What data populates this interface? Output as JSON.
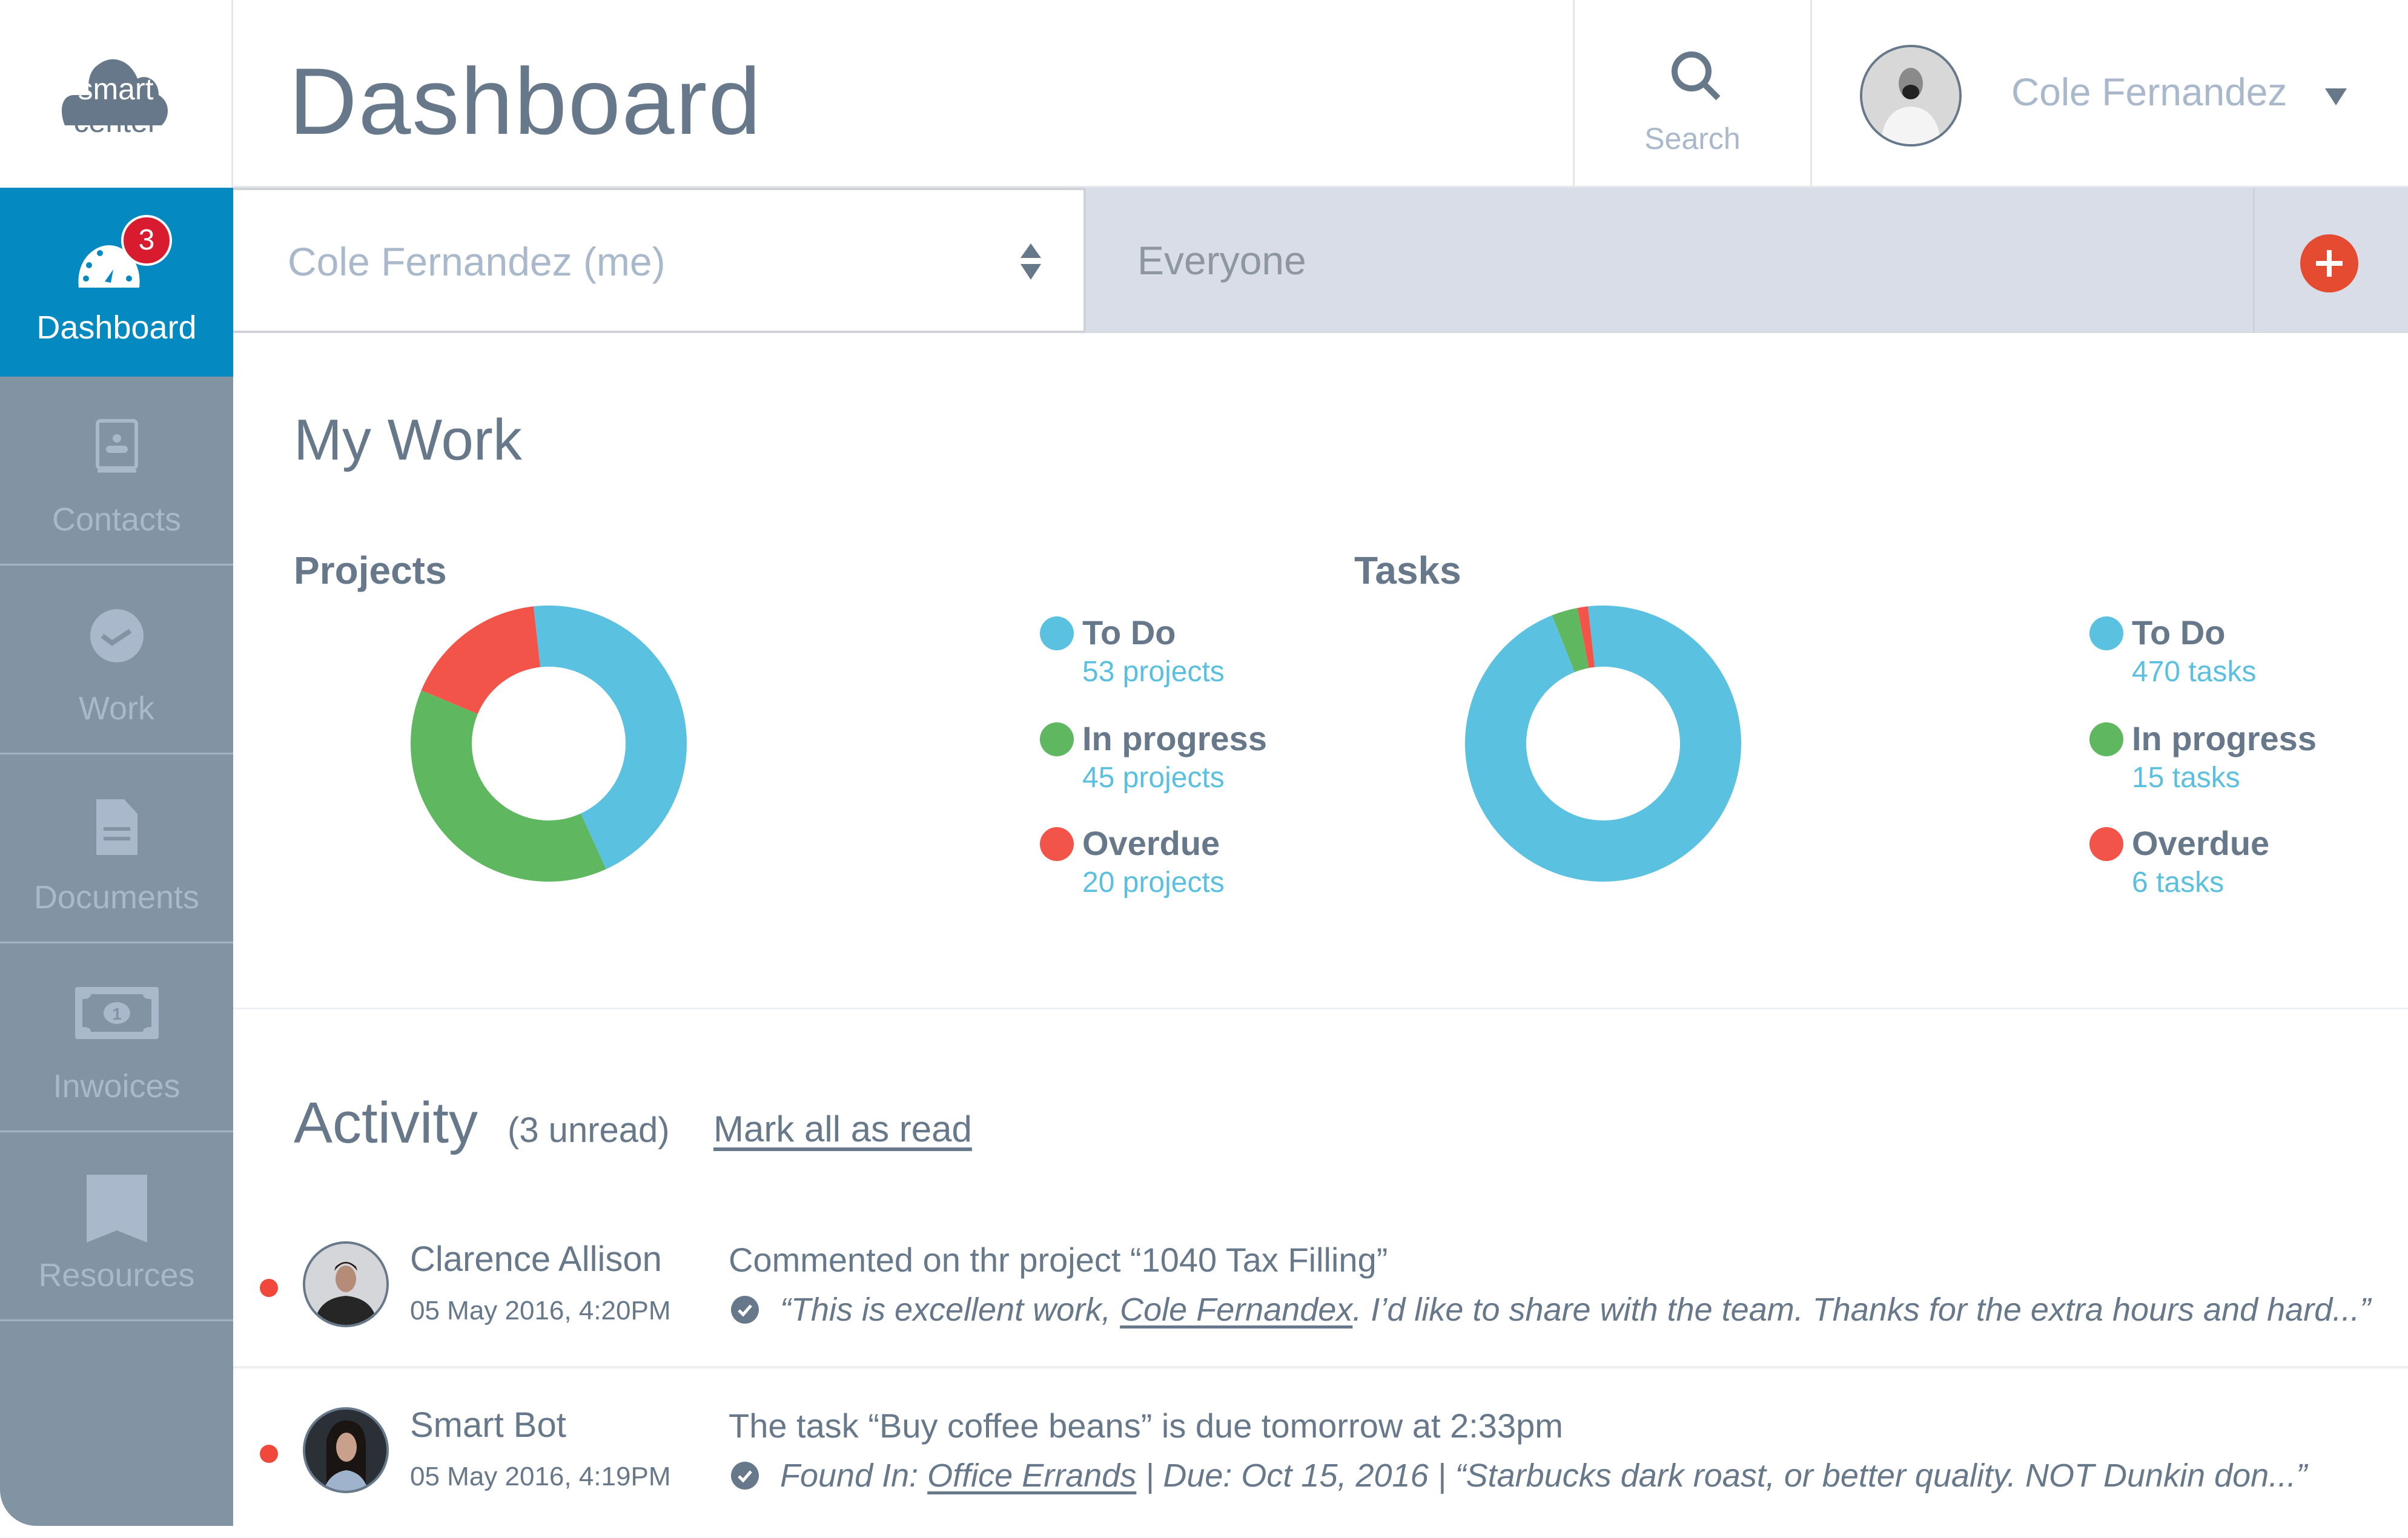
{
  "app": {
    "logo_line1": "smart",
    "logo_line2": "center"
  },
  "header": {
    "title": "Dashboard",
    "search_label": "Search",
    "user_name": "Cole Fernandez"
  },
  "sidebar": {
    "items": [
      {
        "label": "Dashboard",
        "icon": "dashboard-gauge-icon",
        "active": true,
        "badge": "3"
      },
      {
        "label": "Contacts",
        "icon": "contact-card-icon"
      },
      {
        "label": "Work",
        "icon": "check-circle-icon"
      },
      {
        "label": "Documents",
        "icon": "document-icon"
      },
      {
        "label": "Inwoices",
        "icon": "banknote-icon"
      },
      {
        "label": "Resources",
        "icon": "bookmark-icon"
      }
    ]
  },
  "filter": {
    "person_selected": "Cole Fernandez (me)",
    "scope": "Everyone"
  },
  "my_work": {
    "title": "My Work"
  },
  "colors": {
    "todo": "#5bc1e0",
    "in_progress": "#5fb760",
    "overdue": "#f35449",
    "accent": "#0589c1",
    "add": "#e54b30"
  },
  "chart_data": [
    {
      "type": "pie",
      "title": "Projects",
      "categories": [
        "To Do",
        "In progress",
        "Overdue"
      ],
      "values": [
        53,
        45,
        20
      ],
      "value_labels": [
        "53 projects",
        "45 projects",
        "20 projects"
      ],
      "donut": true,
      "legend": "right"
    },
    {
      "type": "pie",
      "title": "Tasks",
      "categories": [
        "To Do",
        "In progress",
        "Overdue"
      ],
      "values": [
        470,
        15,
        6
      ],
      "value_labels": [
        "470 tasks",
        "15 tasks",
        "6 tasks"
      ],
      "donut": true,
      "legend": "right"
    }
  ],
  "activity": {
    "title": "Activity",
    "unread": "(3 unread)",
    "mark_all_read": "Mark all as read",
    "items": [
      {
        "name": "Clarence Allison",
        "date": "05 May 2016, 4:20PM",
        "message": "Commented on thr project “1040 Tax Filling”",
        "detail_pre": "“This is excellent work, ",
        "detail_link": "Cole Fernandex",
        "detail_post": ". I’d like to share with the team. Thanks for the extra hours and hard...”",
        "unread": true
      },
      {
        "name": "Smart Bot",
        "date": "05 May 2016, 4:19PM",
        "message": "The task “Buy coffee beans” is due tomorrow at 2:33pm",
        "detail_pre": "Found In: ",
        "detail_link": "Office Errands",
        "detail_post": " | Due: Oct 15, 2016 | “Starbucks dark roast, or better quality. NOT Dunkin don...”",
        "unread": true
      }
    ]
  }
}
